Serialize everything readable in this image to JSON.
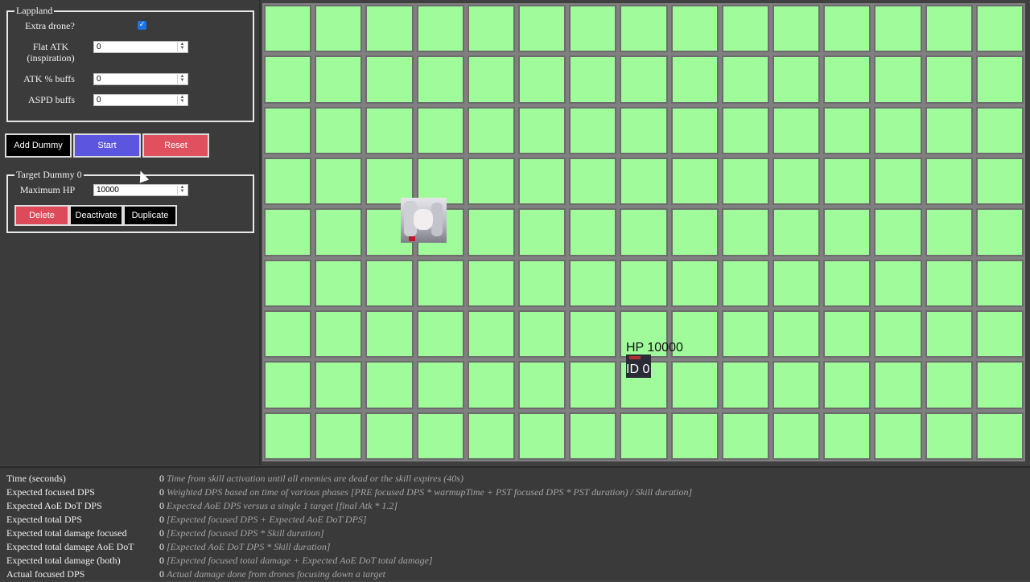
{
  "lappland": {
    "legend": "Lappland",
    "extra_drone_label": "Extra drone?",
    "extra_drone_checked": true,
    "flat_atk_label": "Flat ATK (inspiration)",
    "flat_atk_value": "0",
    "atk_pct_label": "ATK % buffs",
    "atk_pct_value": "0",
    "aspd_label": "ASPD buffs",
    "aspd_value": "0"
  },
  "controls": {
    "add_dummy": "Add Dummy",
    "start": "Start",
    "reset": "Reset"
  },
  "dummy_panel": {
    "legend": "Target Dummy 0",
    "max_hp_label": "Maximum HP",
    "max_hp_value": "10000",
    "delete": "Delete",
    "deactivate": "Deactivate",
    "duplicate": "Duplicate"
  },
  "board": {
    "dummy_hp": "HP 10000",
    "dummy_id": "ID 0"
  },
  "stats": [
    {
      "name": "Time (seconds)",
      "value": "0",
      "desc": "Time from skill activation until all enemies are dead or the skill expires (40s)"
    },
    {
      "name": "Expected focused DPS",
      "value": "0",
      "desc": "Weighted DPS based on time of various phases [PRE focused DPS * warmupTime + PST focused DPS * PST duration) / Skill duration]"
    },
    {
      "name": "Expected AoE DoT DPS",
      "value": "0",
      "desc": "Expected AoE DPS versus a single 1 target [final Atk * 1.2]"
    },
    {
      "name": "Expected total DPS",
      "value": "0",
      "desc": "[Expected focused DPS + Expected AoE DoT DPS]"
    },
    {
      "name": "Expected total damage focused",
      "value": "0",
      "desc": "[Expected focused DPS * Skill duration]"
    },
    {
      "name": "Expected total damage AoE DoT",
      "value": "0",
      "desc": "[Expected AoE DoT DPS * Skill duration]"
    },
    {
      "name": "Expected total damage (both)",
      "value": "0",
      "desc": "[Expected focused total damage + Expected AoE DoT total damage]"
    },
    {
      "name": "Actual focused DPS",
      "value": "0",
      "desc": "Actual damage done from drones focusing down a target"
    }
  ],
  "colors": {
    "tile": "#a0fb9a",
    "start_button": "#5b55e0",
    "reset_button": "#e0505e",
    "delete_button": "#dd4a5a"
  },
  "icons": {
    "operator": "lappland-operator-icon",
    "dummy": "target-dummy-icon"
  }
}
